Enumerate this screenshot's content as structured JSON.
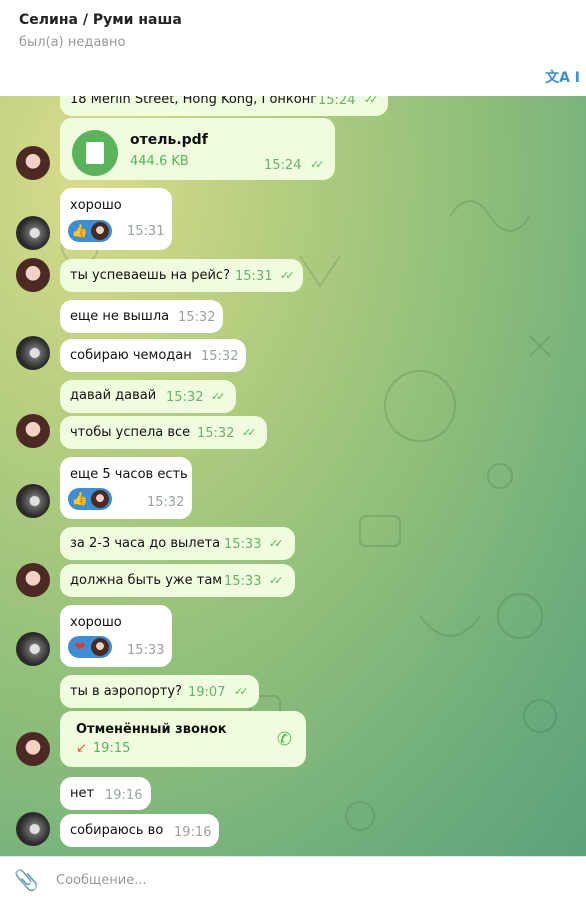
{
  "header": {
    "title": "Селина / Руми наша",
    "status": "был(а) недавно",
    "translate_label": "文A I"
  },
  "messages": {
    "m0_text": "18 Merlin Street, Hong Kong, Гонконг",
    "m0_time": "15:24",
    "file_name": "отель.pdf",
    "file_size": "444.6 KB",
    "file_time": "15:24",
    "m2_text": "хорошо",
    "m2_time": "15:31",
    "m3_text": "ты успеваешь на рейс?",
    "m3_time": "15:31",
    "m4_text": "еще не вышла",
    "m4_time": "15:32",
    "m5_text": "собираю чемодан",
    "m5_time": "15:32",
    "m6_text": "давай давай",
    "m6_time": "15:32",
    "m7_text": "чтобы успела все",
    "m7_time": "15:32",
    "m8_text": "еще 5 часов есть",
    "m8_time": "15:32",
    "m9_text": "за 2-3 часа до вылета",
    "m9_time": "15:33",
    "m10_text": "должна быть уже там",
    "m10_time": "15:33",
    "m11_text": "хорошо",
    "m11_time": "15:33",
    "m12_text": "ты в аэропорту?",
    "m12_time": "19:07",
    "call_title": "Отменённый звонок",
    "call_time": "19:15",
    "m14_text": "нет",
    "m14_time": "19:16",
    "m15_text": "собираюсь во",
    "m15_time": "19:16"
  },
  "reactions": {
    "thumbs": "👍",
    "heart": "❤"
  },
  "composer": {
    "placeholder": "Сообщение..."
  }
}
